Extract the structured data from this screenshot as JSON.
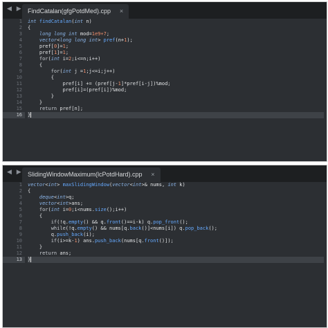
{
  "nav_glyphs": "◀ ▶",
  "pane1": {
    "tab_title": "FindCatalan(gfgPotdMed).cpp",
    "close_glyph": "×",
    "line_numbers": [
      "1",
      "2",
      "3",
      "4",
      "5",
      "6",
      "7",
      "8",
      "9",
      "10",
      "11",
      "12",
      "13",
      "14",
      "15",
      "16"
    ],
    "current_line": 16,
    "lines": [
      "int findCatalan(int n)",
      "{",
      "    long long int mod=1e9+7;",
      "    vector<long long int> pref(n+1);",
      "    pref[0]=1;",
      "    pref[1]=1;",
      "    for(int i=2;i<=n;i++)",
      "    {",
      "        for(int j =1;j<=i;j++)",
      "        {",
      "            pref[i] += (pref[j-1]*pref[i-j])%mod;",
      "            pref[i]=(pref[i])%mod;",
      "        }",
      "    }",
      "    return pref[n];",
      "}"
    ]
  },
  "pane2": {
    "tab_title": "SlidingWindowMaximum(lcPotdHard).cpp",
    "close_glyph": "×",
    "line_numbers": [
      "1",
      "2",
      "3",
      "4",
      "5",
      "6",
      "7",
      "8",
      "9",
      "10",
      "11",
      "12",
      "13"
    ],
    "current_line": 13,
    "lines": [
      "vector<int> maxSlidingWindow(vector<int>& nums, int k)",
      "{",
      "    deque<int>q;",
      "    vector<int>ans;",
      "    for(int i=0;i<nums.size();i++)",
      "    {",
      "        if(!q.empty() && q.front()==i-k) q.pop_front();",
      "        while(!q.empty() && nums[q.back()]<nums[i]) q.pop_back();",
      "        q.push_back(i);",
      "        if(i>=k-1) ans.push_back(nums[q.front()]);",
      "    }",
      "    return ans;",
      "}"
    ]
  }
}
